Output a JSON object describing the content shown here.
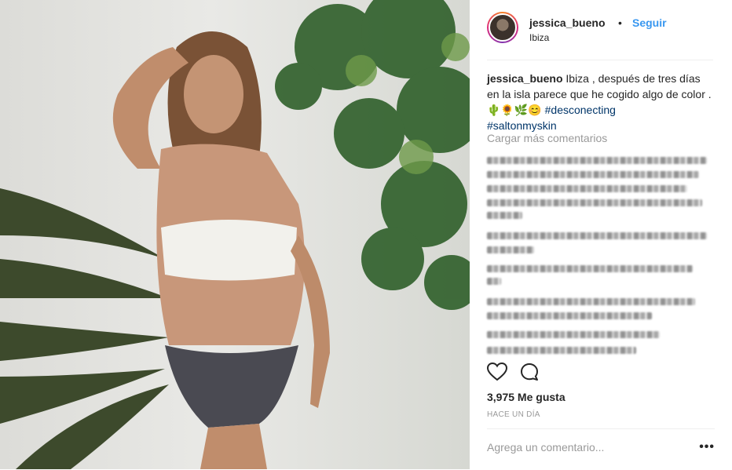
{
  "post": {
    "username": "jessica_bueno",
    "follow_label": "Seguir",
    "location": "Ibiza",
    "caption_text": "Ibiza , después de tres días en la isla parece que he cogido algo de color . 🌵🌻🌿😊",
    "hashtag1": "#desconecting",
    "hashtag2": "#saltonmyskin",
    "load_more_label": "Cargar más comentarios",
    "likes": "3,975 Me gusta",
    "timestamp": "Hace un día",
    "comment_placeholder": "Agrega un comentario...",
    "options_label": "•••"
  },
  "icons": [
    "heart-outline-icon",
    "comment-bubble-icon",
    "more-options-icon"
  ]
}
